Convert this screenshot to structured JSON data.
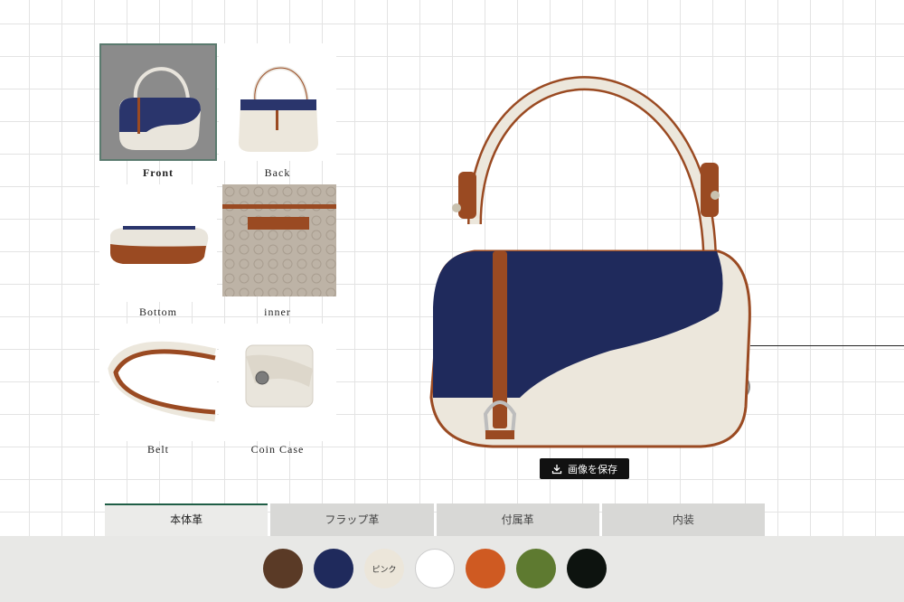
{
  "thumbnails": [
    {
      "label": "Front",
      "selected": true
    },
    {
      "label": "Back",
      "selected": false
    },
    {
      "label": "Bottom",
      "selected": false
    },
    {
      "label": "inner",
      "selected": false
    },
    {
      "label": "Belt",
      "selected": false
    },
    {
      "label": "Coin Case",
      "selected": false
    }
  ],
  "save_button": {
    "label": "画像を保存",
    "icon": "download-icon"
  },
  "tabs": [
    {
      "label": "本体革",
      "active": true
    },
    {
      "label": "フラップ革",
      "active": false
    },
    {
      "label": "付属革",
      "active": false
    },
    {
      "label": "内装",
      "active": false
    }
  ],
  "swatches": [
    {
      "color": "#5a3a26",
      "label": ""
    },
    {
      "color": "#1f2a5c",
      "label": ""
    },
    {
      "color": "#ece6da",
      "label": "ピンク"
    },
    {
      "color": "#ffffff",
      "label": ""
    },
    {
      "color": "#cf5a22",
      "label": ""
    },
    {
      "color": "#5e7a30",
      "label": ""
    },
    {
      "color": "#0d130f",
      "label": ""
    }
  ],
  "colors": {
    "navy": "#1f2a5c",
    "cream": "#ece7dc",
    "tan": "#9a4a22",
    "accent_green": "#1f5e46"
  }
}
